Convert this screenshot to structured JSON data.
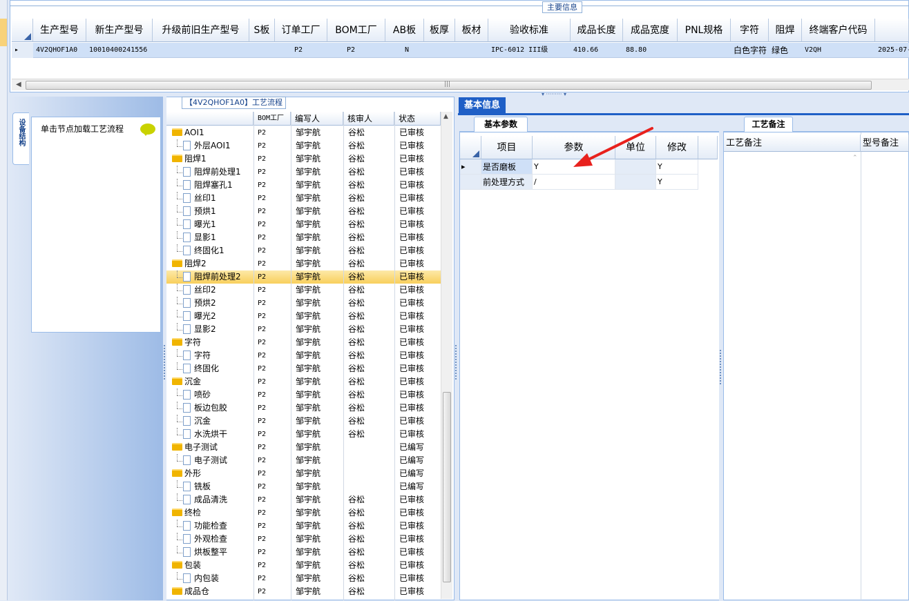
{
  "main_info": {
    "legend": "主要信息",
    "columns": [
      "生产型号",
      "新生产型号",
      "升级前旧生产型号",
      "S板",
      "订单工厂",
      "BOM工厂",
      "AB板",
      "板厚",
      "板材",
      "验收标准",
      "成品长度",
      "成品宽度",
      "PNL规格",
      "字符",
      "阻焊",
      "终端客户代码"
    ],
    "row": {
      "indicator": "▸",
      "cells": [
        "4V2QHOF1A0",
        "10010400241556",
        "",
        "",
        "P2",
        "P2",
        "N",
        "",
        "",
        "IPC-6012 III级",
        "410.66",
        "88.80",
        "",
        "白色字符",
        "绿色",
        "V2QH"
      ],
      "overflow": "2025-07-"
    }
  },
  "nav": {
    "vertical_tab": "设备结构",
    "title": "单击节点加载工艺流程"
  },
  "process": {
    "legend": "【4V2QHOF1A0】工艺流程",
    "columns": [
      "",
      "BOM工厂",
      "编写人",
      "核审人",
      "状态"
    ],
    "rows": [
      {
        "level": 0,
        "type": "folder",
        "name": "AOI1",
        "bom": "P2",
        "writer": "邹宇航",
        "reviewer": "谷松",
        "status": "已审核"
      },
      {
        "level": 1,
        "type": "doc",
        "name": "外层AOI1",
        "bom": "P2",
        "writer": "邹宇航",
        "reviewer": "谷松",
        "status": "已审核"
      },
      {
        "level": 0,
        "type": "folder",
        "name": "阻焊1",
        "bom": "P2",
        "writer": "邹宇航",
        "reviewer": "谷松",
        "status": "已审核"
      },
      {
        "level": 1,
        "type": "doc",
        "name": "阻焊前处理1",
        "bom": "P2",
        "writer": "邹宇航",
        "reviewer": "谷松",
        "status": "已审核"
      },
      {
        "level": 1,
        "type": "doc",
        "name": "阻焊塞孔1",
        "bom": "P2",
        "writer": "邹宇航",
        "reviewer": "谷松",
        "status": "已审核"
      },
      {
        "level": 1,
        "type": "doc",
        "name": "丝印1",
        "bom": "P2",
        "writer": "邹宇航",
        "reviewer": "谷松",
        "status": "已审核"
      },
      {
        "level": 1,
        "type": "doc",
        "name": "预烘1",
        "bom": "P2",
        "writer": "邹宇航",
        "reviewer": "谷松",
        "status": "已审核"
      },
      {
        "level": 1,
        "type": "doc",
        "name": "曝光1",
        "bom": "P2",
        "writer": "邹宇航",
        "reviewer": "谷松",
        "status": "已审核"
      },
      {
        "level": 1,
        "type": "doc",
        "name": "显影1",
        "bom": "P2",
        "writer": "邹宇航",
        "reviewer": "谷松",
        "status": "已审核"
      },
      {
        "level": 1,
        "type": "doc",
        "name": "终固化1",
        "bom": "P2",
        "writer": "邹宇航",
        "reviewer": "谷松",
        "status": "已审核"
      },
      {
        "level": 0,
        "type": "folder",
        "name": "阻焊2",
        "bom": "P2",
        "writer": "邹宇航",
        "reviewer": "谷松",
        "status": "已审核"
      },
      {
        "level": 1,
        "type": "doc",
        "name": "阻焊前处理2",
        "bom": "P2",
        "writer": "邹宇航",
        "reviewer": "谷松",
        "status": "已审核",
        "selected": true
      },
      {
        "level": 1,
        "type": "doc",
        "name": "丝印2",
        "bom": "P2",
        "writer": "邹宇航",
        "reviewer": "谷松",
        "status": "已审核"
      },
      {
        "level": 1,
        "type": "doc",
        "name": "预烘2",
        "bom": "P2",
        "writer": "邹宇航",
        "reviewer": "谷松",
        "status": "已审核"
      },
      {
        "level": 1,
        "type": "doc",
        "name": "曝光2",
        "bom": "P2",
        "writer": "邹宇航",
        "reviewer": "谷松",
        "status": "已审核"
      },
      {
        "level": 1,
        "type": "doc",
        "name": "显影2",
        "bom": "P2",
        "writer": "邹宇航",
        "reviewer": "谷松",
        "status": "已审核"
      },
      {
        "level": 0,
        "type": "folder",
        "name": "字符",
        "bom": "P2",
        "writer": "邹宇航",
        "reviewer": "谷松",
        "status": "已审核"
      },
      {
        "level": 1,
        "type": "doc",
        "name": "字符",
        "bom": "P2",
        "writer": "邹宇航",
        "reviewer": "谷松",
        "status": "已审核"
      },
      {
        "level": 1,
        "type": "doc",
        "name": "终固化",
        "bom": "P2",
        "writer": "邹宇航",
        "reviewer": "谷松",
        "status": "已审核"
      },
      {
        "level": 0,
        "type": "folder",
        "name": "沉金",
        "bom": "P2",
        "writer": "邹宇航",
        "reviewer": "谷松",
        "status": "已审核"
      },
      {
        "level": 1,
        "type": "doc",
        "name": "喷砂",
        "bom": "P2",
        "writer": "邹宇航",
        "reviewer": "谷松",
        "status": "已审核"
      },
      {
        "level": 1,
        "type": "doc",
        "name": "板边包胶",
        "bom": "P2",
        "writer": "邹宇航",
        "reviewer": "谷松",
        "status": "已审核"
      },
      {
        "level": 1,
        "type": "doc",
        "name": "沉金",
        "bom": "P2",
        "writer": "邹宇航",
        "reviewer": "谷松",
        "status": "已审核"
      },
      {
        "level": 1,
        "type": "doc",
        "name": "水洗烘干",
        "bom": "P2",
        "writer": "邹宇航",
        "reviewer": "谷松",
        "status": "已审核"
      },
      {
        "level": 0,
        "type": "folder",
        "name": "电子测试",
        "bom": "P2",
        "writer": "邹宇航",
        "reviewer": "",
        "status": "已编写"
      },
      {
        "level": 1,
        "type": "doc",
        "name": "电子测试",
        "bom": "P2",
        "writer": "邹宇航",
        "reviewer": "",
        "status": "已编写"
      },
      {
        "level": 0,
        "type": "folder",
        "name": "外形",
        "bom": "P2",
        "writer": "邹宇航",
        "reviewer": "",
        "status": "已编写"
      },
      {
        "level": 1,
        "type": "doc",
        "name": "铣板",
        "bom": "P2",
        "writer": "邹宇航",
        "reviewer": "",
        "status": "已编写"
      },
      {
        "level": 1,
        "type": "doc",
        "name": "成品清洗",
        "bom": "P2",
        "writer": "邹宇航",
        "reviewer": "谷松",
        "status": "已审核"
      },
      {
        "level": 0,
        "type": "folder",
        "name": "终检",
        "bom": "P2",
        "writer": "邹宇航",
        "reviewer": "谷松",
        "status": "已审核"
      },
      {
        "level": 1,
        "type": "doc",
        "name": "功能检查",
        "bom": "P2",
        "writer": "邹宇航",
        "reviewer": "谷松",
        "status": "已审核"
      },
      {
        "level": 1,
        "type": "doc",
        "name": "外观检查",
        "bom": "P2",
        "writer": "邹宇航",
        "reviewer": "谷松",
        "status": "已审核"
      },
      {
        "level": 1,
        "type": "doc",
        "name": "烘板整平",
        "bom": "P2",
        "writer": "邹宇航",
        "reviewer": "谷松",
        "status": "已审核"
      },
      {
        "level": 0,
        "type": "folder",
        "name": "包装",
        "bom": "P2",
        "writer": "邹宇航",
        "reviewer": "谷松",
        "status": "已审核"
      },
      {
        "level": 1,
        "type": "doc",
        "name": "内包装",
        "bom": "P2",
        "writer": "邹宇航",
        "reviewer": "谷松",
        "status": "已审核"
      },
      {
        "level": 0,
        "type": "folder",
        "name": "成品仓",
        "bom": "P2",
        "writer": "邹宇航",
        "reviewer": "谷松",
        "status": "已审核"
      }
    ]
  },
  "basic_info": {
    "tab": "基本信息",
    "param_tab": "基本参数",
    "columns": [
      "项目",
      "参数",
      "单位",
      "修改"
    ],
    "rows": [
      {
        "item": "是否磨板",
        "param": "Y",
        "unit": "",
        "modify": "Y",
        "current": true
      },
      {
        "item": "前处理方式",
        "param": "/",
        "unit": "",
        "modify": "Y"
      }
    ]
  },
  "remarks": {
    "tab": "工艺备注",
    "columns": [
      "工艺备注",
      "型号备注"
    ]
  },
  "annotation": {
    "arrow_color": "#e8211d"
  }
}
